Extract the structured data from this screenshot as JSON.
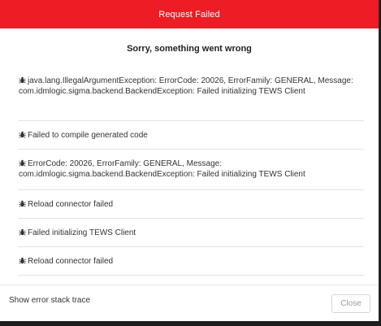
{
  "dialog": {
    "title": "Request Failed",
    "subtitle": "Sorry, something went wrong"
  },
  "errors": [
    {
      "icon": "bug-icon",
      "text": "java.lang.IllegalArgumentException: ErrorCode: 20026, ErrorFamily: GENERAL, Message: com.idmlogic.sigma.backend.BackendException: Failed initializing TEWS Client"
    },
    {
      "icon": "bug-icon",
      "text": "Failed to compile generated code"
    },
    {
      "icon": "bug-icon",
      "text": "ErrorCode: 20026, ErrorFamily: GENERAL, Message: com.idmlogic.sigma.backend.BackendException: Failed initializing TEWS Client"
    },
    {
      "icon": "bug-icon",
      "text": "Reload connector failed"
    },
    {
      "icon": "bug-icon",
      "text": "Failed initializing TEWS Client"
    },
    {
      "icon": "bug-icon",
      "text": "Reload connector failed"
    }
  ],
  "footer": {
    "stack_trace_label": "Show error stack trace",
    "close_label": "Close"
  },
  "colors": {
    "header_bg": "#ee1c24",
    "header_text": "#ffffff"
  }
}
